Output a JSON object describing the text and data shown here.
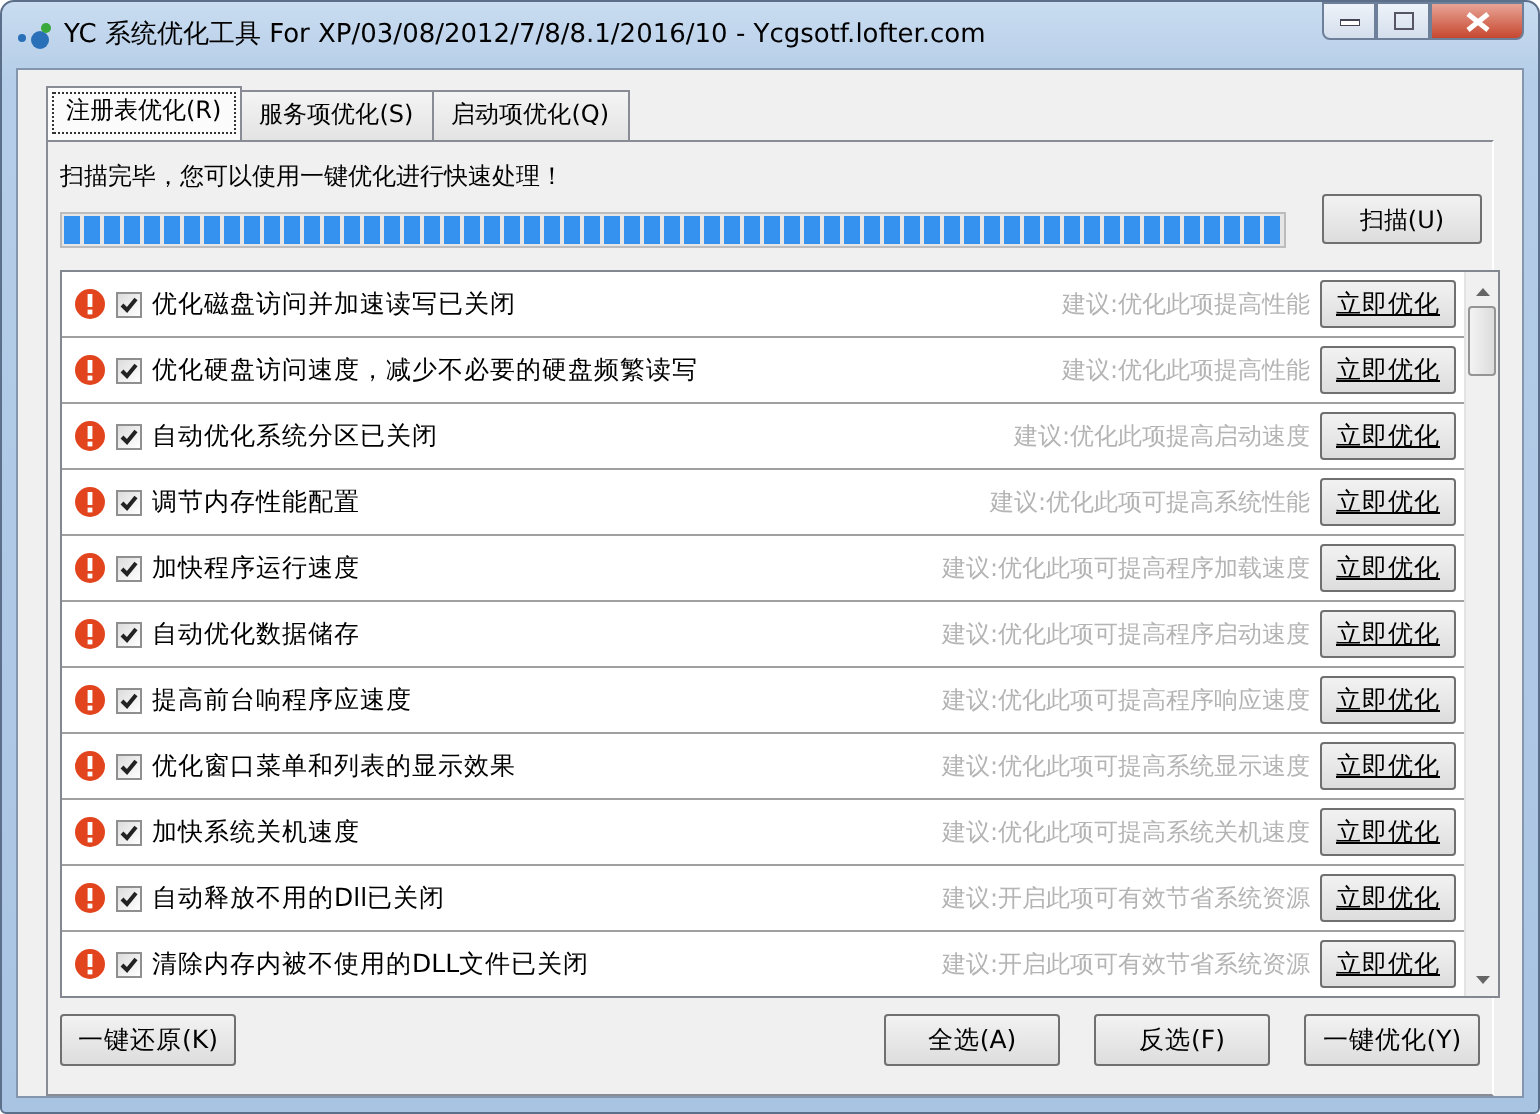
{
  "window": {
    "title": "YC 系统优化工具 For XP/03/08/2012/7/8/8.1/2016/10 - Ycgsotf.lofter.com"
  },
  "tabs": [
    {
      "label": "注册表优化(R)",
      "selected": true
    },
    {
      "label": "服务项优化(S)",
      "selected": false
    },
    {
      "label": "启动项优化(Q)",
      "selected": false
    }
  ],
  "status_text": "扫描完毕，您可以使用一键优化进行快速处理！",
  "progress": {
    "level": 1
  },
  "scan_button": "扫描(U)",
  "items": [
    {
      "label": "优化磁盘访问并加速读写已关闭",
      "checked": true,
      "suggestion": "建议:优化此项提高性能",
      "action": "立即优化"
    },
    {
      "label": "优化硬盘访问速度，减少不必要的硬盘频繁读写",
      "checked": true,
      "suggestion": "建议:优化此项提高性能",
      "action": "立即优化"
    },
    {
      "label": "自动优化系统分区已关闭",
      "checked": true,
      "suggestion": "建议:优化此项提高启动速度",
      "action": "立即优化"
    },
    {
      "label": "调节内存性能配置",
      "checked": true,
      "suggestion": "建议:优化此项可提高系统性能",
      "action": "立即优化"
    },
    {
      "label": "加快程序运行速度",
      "checked": true,
      "suggestion": "建议:优化此项可提高程序加载速度",
      "action": "立即优化"
    },
    {
      "label": "自动优化数据储存",
      "checked": true,
      "suggestion": "建议:优化此项可提高程序启动速度",
      "action": "立即优化"
    },
    {
      "label": "提高前台响程序应速度",
      "checked": true,
      "suggestion": "建议:优化此项可提高程序响应速度",
      "action": "立即优化"
    },
    {
      "label": "优化窗口菜单和列表的显示效果",
      "checked": true,
      "suggestion": "建议:优化此项可提高系统显示速度",
      "action": "立即优化"
    },
    {
      "label": "加快系统关机速度",
      "checked": true,
      "suggestion": "建议:优化此项可提高系统关机速度",
      "action": "立即优化"
    },
    {
      "label": "自动释放不用的Dll已关闭",
      "checked": true,
      "suggestion": "建议:开启此项可有效节省系统资源",
      "action": "立即优化"
    },
    {
      "label": "清除内存内被不使用的DLL文件已关闭",
      "checked": true,
      "suggestion": "建议:开启此项可有效节省系统资源",
      "action": "立即优化"
    }
  ],
  "footer_buttons": [
    {
      "label": "一键还原(K)",
      "kind": "left"
    },
    {
      "label": "全选(A)",
      "kind": "right"
    },
    {
      "label": "反选(F)",
      "kind": "right"
    },
    {
      "label": "一键优化(Y)",
      "kind": "right"
    }
  ]
}
